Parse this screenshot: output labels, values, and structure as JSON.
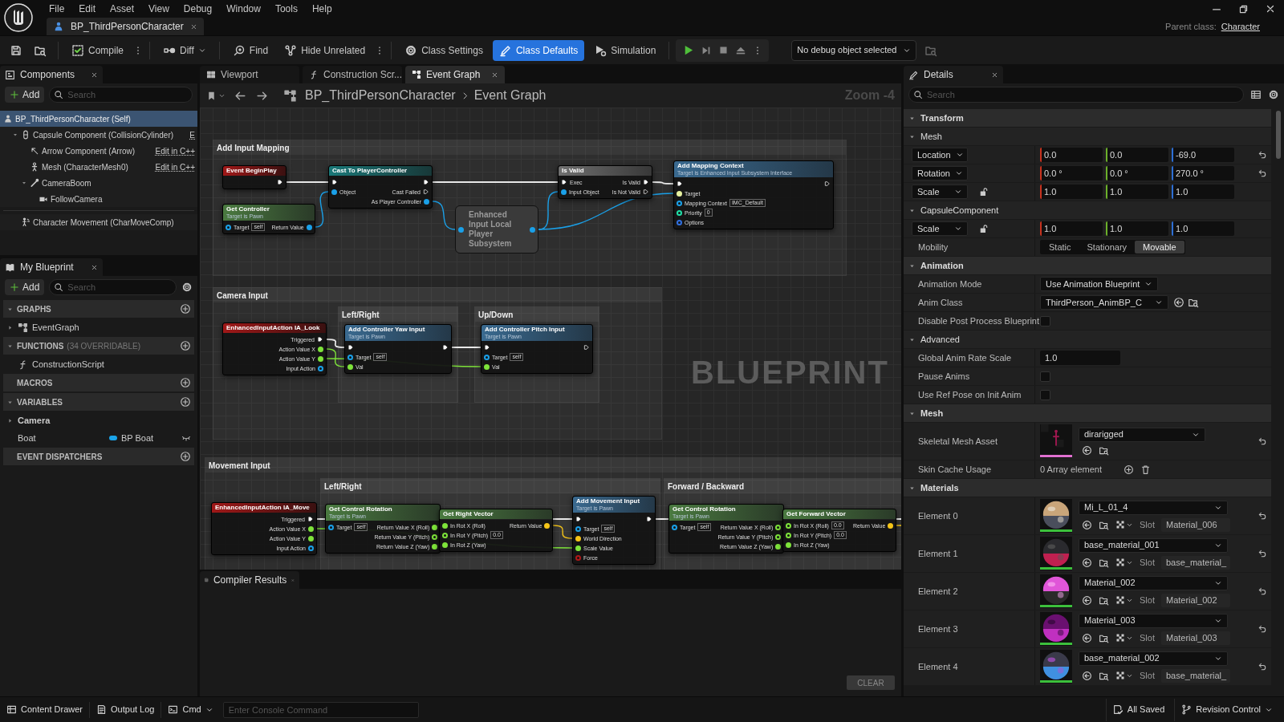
{
  "menu": [
    "File",
    "Edit",
    "Asset",
    "View",
    "Debug",
    "Window",
    "Tools",
    "Help"
  ],
  "document_tab": {
    "label": "BP_ThirdPersonCharacter",
    "selected": true
  },
  "parent_class": {
    "label": "Parent class:",
    "value": "Character"
  },
  "toolbar": [
    {
      "kind": "compile",
      "label": "Compile",
      "selected": false
    },
    {
      "kind": "diff",
      "label": "Diff",
      "selected": false
    },
    {
      "kind": "find",
      "label": "Find",
      "selected": false
    },
    {
      "kind": "hide_unrelated",
      "label": "Hide Unrelated",
      "selected": false
    },
    {
      "kind": "class_settings",
      "label": "Class Settings",
      "selected": false
    },
    {
      "kind": "class_defaults",
      "label": "Class Defaults",
      "selected": true
    },
    {
      "kind": "simulation",
      "label": "Simulation",
      "selected": false
    }
  ],
  "debug_object": "No debug object selected",
  "components": {
    "title": "Components",
    "add": "Add",
    "search_placeholder": "Search",
    "tree": [
      {
        "kind": "actor",
        "label": "BP_ThirdPersonCharacter (Self)",
        "selected": true,
        "children": [
          {
            "kind": "capsule",
            "label": "Capsule Component (CollisionCylinder)",
            "suffix": "E",
            "selected": false,
            "expanded": true,
            "children": [
              {
                "kind": "arrow",
                "label": "Arrow Component (Arrow)",
                "suffix": "Edit in C++",
                "selected": false
              },
              {
                "kind": "mesh",
                "label": "Mesh (CharacterMesh0)",
                "suffix": "Edit in C++",
                "selected": false
              },
              {
                "kind": "spring_arm",
                "label": "CameraBoom",
                "selected": false,
                "expanded": true,
                "children": [
                  {
                    "kind": "camera",
                    "label": "FollowCamera",
                    "selected": false
                  }
                ]
              }
            ]
          },
          {
            "kind": "movement",
            "label": "Character Movement (CharMoveComp)",
            "selected": false
          }
        ]
      }
    ]
  },
  "my_blueprint": {
    "title": "My Blueprint",
    "add": "Add",
    "search_placeholder": "Search",
    "sections": [
      {
        "title": "GRAPHS",
        "expanded": true,
        "items": [
          {
            "kind": "graph",
            "label": "EventGraph",
            "expanded": false
          }
        ]
      },
      {
        "title": "FUNCTIONS",
        "note": "(34 OVERRIDABLE)",
        "expanded": true,
        "items": [
          {
            "kind": "function",
            "label": "ConstructionScript"
          }
        ]
      },
      {
        "title": "MACROS"
      },
      {
        "title": "VARIABLES",
        "expanded": true,
        "items": [
          {
            "kind": "category",
            "label": "Camera",
            "expanded": false
          },
          {
            "kind": "variable",
            "label": "Boat",
            "type": "BP Boat",
            "color": "#1aa3e8"
          }
        ]
      },
      {
        "title": "EVENT DISPATCHERS"
      }
    ]
  },
  "graph_tabs": [
    {
      "kind": "viewport",
      "label": "Viewport",
      "selected": false
    },
    {
      "kind": "function",
      "label": "Construction Scr...",
      "selected": false
    },
    {
      "kind": "graph",
      "label": "Event Graph",
      "selected": true
    }
  ],
  "breadcrumb": [
    "BP_ThirdPersonCharacter",
    "Event Graph"
  ],
  "zoom": "Zoom -4",
  "graph": {
    "comments": [
      {
        "title": "Add Input Mapping"
      },
      {
        "title": "Camera Input"
      },
      {
        "title": "Left/Right"
      },
      {
        "title": "Up/Down"
      },
      {
        "title": "Movement Input"
      },
      {
        "title": "Left/Right"
      },
      {
        "title": "Forward / Backward"
      }
    ],
    "nodes": [
      {
        "kind": "event",
        "title": "Event BeginPlay",
        "outputs": [
          {
            "kind": "exec",
            "connected": true
          }
        ]
      },
      {
        "kind": "pure",
        "title": "Get Controller",
        "subtitle": "Target is Pawn",
        "inputs": [
          {
            "kind": "data",
            "color": "#1aa0e8",
            "label": "Target",
            "default": "self",
            "connected": false
          }
        ],
        "outputs": [
          {
            "kind": "data",
            "color": "#1aa0e8",
            "label": "Return Value",
            "connected": true
          }
        ]
      },
      {
        "kind": "cast",
        "title": "Cast To PlayerController",
        "inputs": [
          {
            "kind": "exec",
            "connected": true
          },
          {
            "kind": "data",
            "color": "#1aa0e8",
            "label": "Object",
            "connected": true
          }
        ],
        "outputs": [
          {
            "kind": "exec",
            "connected": true
          },
          {
            "kind": "exec",
            "label": "Cast Failed",
            "connected": false
          },
          {
            "kind": "data",
            "color": "#1aa0e8",
            "label": "As Player Controller",
            "connected": true
          }
        ]
      },
      {
        "kind": "compact",
        "title": "Enhanced Input Local Player Subsystem",
        "inputs": [
          {
            "kind": "data",
            "color": "#1aa0e8",
            "connected": true
          }
        ],
        "outputs": [
          {
            "kind": "data",
            "color": "#1aa0e8",
            "connected": true
          }
        ]
      },
      {
        "kind": "macro",
        "title": "Is Valid",
        "inputs": [
          {
            "kind": "exec",
            "label": "Exec",
            "connected": true
          },
          {
            "kind": "data",
            "color": "#1aa0e8",
            "label": "Input Object",
            "connected": true
          }
        ],
        "outputs": [
          {
            "kind": "exec",
            "label": "Is Valid",
            "connected": true
          },
          {
            "kind": "exec",
            "label": "Is Not Valid",
            "connected": false
          }
        ]
      },
      {
        "kind": "function",
        "title": "Add Mapping Context",
        "subtitle": "Target is Enhanced Input Subsystem Interface",
        "inputs": [
          {
            "kind": "exec",
            "connected": true
          },
          {
            "kind": "data",
            "color": "#e6f1a0",
            "label": "Target",
            "connected": true
          },
          {
            "kind": "data",
            "color": "#1aa0e8",
            "label": "Mapping Context",
            "default": "IMC_Default",
            "connected": false
          },
          {
            "kind": "data",
            "color": "#1fe0a8",
            "label": "Priority",
            "default": "0",
            "connected": false
          },
          {
            "kind": "data",
            "color": "#3070e0",
            "label": "Options",
            "connected": false
          }
        ],
        "outputs": [
          {
            "kind": "exec",
            "connected": false
          }
        ]
      },
      {
        "kind": "event",
        "title": "EnhancedInputAction IA_Look",
        "outputs": [
          {
            "kind": "exec",
            "label": "Triggered",
            "connected": true
          },
          {
            "kind": "data",
            "color": "#7ee33a",
            "label": "Action Value X",
            "connected": true
          },
          {
            "kind": "data",
            "color": "#7ee33a",
            "label": "Action Value Y",
            "connected": true
          },
          {
            "kind": "data",
            "color": "#1aa0e8",
            "label": "Input Action",
            "connected": false
          }
        ]
      },
      {
        "kind": "function",
        "title": "Add Controller Yaw Input",
        "subtitle": "Target is Pawn",
        "inputs": [
          {
            "kind": "exec",
            "connected": true
          },
          {
            "kind": "data",
            "color": "#1aa0e8",
            "label": "Target",
            "default": "self",
            "connected": false
          },
          {
            "kind": "data",
            "color": "#7ee33a",
            "label": "Val",
            "connected": true
          }
        ],
        "outputs": [
          {
            "kind": "exec",
            "connected": true
          }
        ]
      },
      {
        "kind": "function",
        "title": "Add Controller Pitch Input",
        "subtitle": "Target is Pawn",
        "inputs": [
          {
            "kind": "exec",
            "connected": true
          },
          {
            "kind": "data",
            "color": "#1aa0e8",
            "label": "Target",
            "default": "self",
            "connected": false
          },
          {
            "kind": "data",
            "color": "#7ee33a",
            "label": "Val",
            "connected": true
          }
        ],
        "outputs": [
          {
            "kind": "exec",
            "connected": false
          }
        ]
      },
      {
        "kind": "event",
        "title": "EnhancedInputAction IA_Move",
        "outputs": [
          {
            "kind": "exec",
            "label": "Triggered",
            "connected": true
          },
          {
            "kind": "data",
            "color": "#7ee33a",
            "label": "Action Value X",
            "connected": true
          },
          {
            "kind": "data",
            "color": "#7ee33a",
            "label": "Action Value Y",
            "connected": true
          },
          {
            "kind": "data",
            "color": "#1aa0e8",
            "label": "Input Action",
            "connected": false
          }
        ]
      },
      {
        "kind": "pure",
        "title": "Get Control Rotation",
        "subtitle": "Target is Pawn",
        "inputs": [
          {
            "kind": "data",
            "color": "#1aa0e8",
            "label": "Target",
            "default": "self",
            "connected": false
          }
        ],
        "outputs": [
          {
            "kind": "data",
            "color": "#7ee33a",
            "label": "Return Value X (Roll)",
            "connected": true
          },
          {
            "kind": "data",
            "color": "#7ee33a",
            "label": "Return Value Y (Pitch)",
            "connected": false
          },
          {
            "kind": "data",
            "color": "#7ee33a",
            "label": "Return Value Z (Yaw)",
            "connected": true
          }
        ]
      },
      {
        "kind": "pure",
        "title": "Get Right Vector",
        "inputs": [
          {
            "kind": "data",
            "color": "#7ee33a",
            "label": "In Rot X (Roll)",
            "connected": true
          },
          {
            "kind": "data",
            "color": "#7ee33a",
            "label": "In Rot Y (Pitch)",
            "default": "0.0",
            "connected": false
          },
          {
            "kind": "data",
            "color": "#7ee33a",
            "label": "In Rot Z (Yaw)",
            "connected": true
          }
        ],
        "outputs": [
          {
            "kind": "data",
            "color": "#f5c518",
            "label": "Return Value",
            "connected": true
          }
        ]
      },
      {
        "kind": "function",
        "title": "Add Movement Input",
        "subtitle": "Target is Pawn",
        "inputs": [
          {
            "kind": "exec",
            "connected": true
          },
          {
            "kind": "data",
            "color": "#1aa0e8",
            "label": "Target",
            "default": "self",
            "connected": false
          },
          {
            "kind": "data",
            "color": "#f5c518",
            "label": "World Direction",
            "connected": true
          },
          {
            "kind": "data",
            "color": "#7ee33a",
            "label": "Scale Value",
            "connected": true
          },
          {
            "kind": "data",
            "color": "#b01818",
            "label": "Force",
            "connected": false
          }
        ],
        "outputs": [
          {
            "kind": "exec",
            "connected": true
          }
        ]
      },
      {
        "kind": "pure",
        "title": "Get Control Rotation",
        "subtitle": "Target is Pawn",
        "inputs": [
          {
            "kind": "data",
            "color": "#1aa0e8",
            "label": "Target",
            "default": "self",
            "connected": false
          }
        ],
        "outputs": [
          {
            "kind": "data",
            "color": "#7ee33a",
            "label": "Return Value X (Roll)",
            "connected": false
          },
          {
            "kind": "data",
            "color": "#7ee33a",
            "label": "Return Value Y (Pitch)",
            "connected": false
          },
          {
            "kind": "data",
            "color": "#7ee33a",
            "label": "Return Value Z (Yaw)",
            "connected": true
          }
        ]
      },
      {
        "kind": "pure",
        "title": "Get Forward Vector",
        "inputs": [
          {
            "kind": "data",
            "color": "#7ee33a",
            "label": "In Rot X (Roll)",
            "default": "0.0",
            "connected": false
          },
          {
            "kind": "data",
            "color": "#7ee33a",
            "label": "In Rot Y (Pitch)",
            "default": "0.0",
            "connected": false
          },
          {
            "kind": "data",
            "color": "#7ee33a",
            "label": "In Rot Z (Yaw)",
            "connected": true
          }
        ],
        "outputs": [
          {
            "kind": "data",
            "color": "#f5c518",
            "label": "Return Value",
            "connected": true
          }
        ]
      }
    ],
    "watermark": "BLUEPRINT"
  },
  "compiler": {
    "title": "Compiler Results",
    "clear": "CLEAR"
  },
  "details": {
    "title": "Details",
    "search_placeholder": "Search",
    "rows": [
      {
        "kind": "category",
        "label": "Transform",
        "expanded": true
      },
      {
        "kind": "subcategory",
        "label": "Mesh",
        "expanded": true
      },
      {
        "kind": "vector",
        "label": "Location",
        "values": [
          "0.0",
          "0.0",
          "-69.0"
        ],
        "reset": true
      },
      {
        "kind": "vector",
        "label": "Rotation",
        "values": [
          "0.0 °",
          "0.0 °",
          "270.0 °"
        ],
        "reset": true
      },
      {
        "kind": "vector",
        "label": "Scale",
        "values": [
          "1.0",
          "1.0",
          "1.0"
        ],
        "locked": false,
        "reset": false
      },
      {
        "kind": "subcategory",
        "label": "CapsuleComponent",
        "expanded": true
      },
      {
        "kind": "vector",
        "label": "Scale",
        "values": [
          "1.0",
          "1.0",
          "1.0"
        ],
        "locked": false,
        "reset": false
      },
      {
        "kind": "segmented",
        "label": "Mobility",
        "options": [
          {
            "label": "Static",
            "selected": false
          },
          {
            "label": "Stationary",
            "selected": false
          },
          {
            "label": "Movable",
            "selected": true
          }
        ]
      },
      {
        "kind": "category",
        "label": "Animation",
        "expanded": true
      },
      {
        "kind": "dropdown",
        "label": "Animation Mode",
        "value": "Use Animation Blueprint"
      },
      {
        "kind": "class_picker",
        "label": "Anim Class",
        "value": "ThirdPerson_AnimBP_C"
      },
      {
        "kind": "checkbox",
        "label": "Disable Post Process Blueprint",
        "checked": false
      },
      {
        "kind": "subcategory",
        "label": "Advanced",
        "expanded": true
      },
      {
        "kind": "number",
        "label": "Global Anim Rate Scale",
        "value": "1.0"
      },
      {
        "kind": "checkbox",
        "label": "Pause Anims",
        "checked": false
      },
      {
        "kind": "checkbox",
        "label": "Use Ref Pose on Init Anim",
        "checked": false
      },
      {
        "kind": "category",
        "label": "Mesh",
        "expanded": true
      },
      {
        "kind": "asset",
        "label": "Skeletal Mesh Asset",
        "value": "dirarigged",
        "reset": true
      },
      {
        "kind": "array",
        "label": "Skin Cache Usage",
        "value": "0 Array element"
      },
      {
        "kind": "category",
        "label": "Materials",
        "expanded": true
      },
      {
        "kind": "material",
        "label": "Element 0",
        "value": "Mi_L_01_4",
        "slot_label": "Slot",
        "slot": "Material_006",
        "reset": true
      },
      {
        "kind": "material",
        "label": "Element 1",
        "value": "base_material_001",
        "slot_label": "Slot",
        "slot": "base_material_",
        "reset": true
      },
      {
        "kind": "material",
        "label": "Element 2",
        "value": "Material_002",
        "slot_label": "Slot",
        "slot": "Material_002",
        "reset": true
      },
      {
        "kind": "material",
        "label": "Element 3",
        "value": "Material_003",
        "slot_label": "Slot",
        "slot": "Material_003",
        "reset": true
      },
      {
        "kind": "material",
        "label": "Element 4",
        "value": "base_material_002",
        "slot_label": "Slot",
        "slot": "base_material_",
        "reset": true
      }
    ]
  },
  "status_bar": {
    "content_drawer": "Content Drawer",
    "output_log": "Output Log",
    "cmd": "Cmd",
    "console_placeholder": "Enter Console Command",
    "saved": "All Saved",
    "revision_control": "Revision Control"
  }
}
